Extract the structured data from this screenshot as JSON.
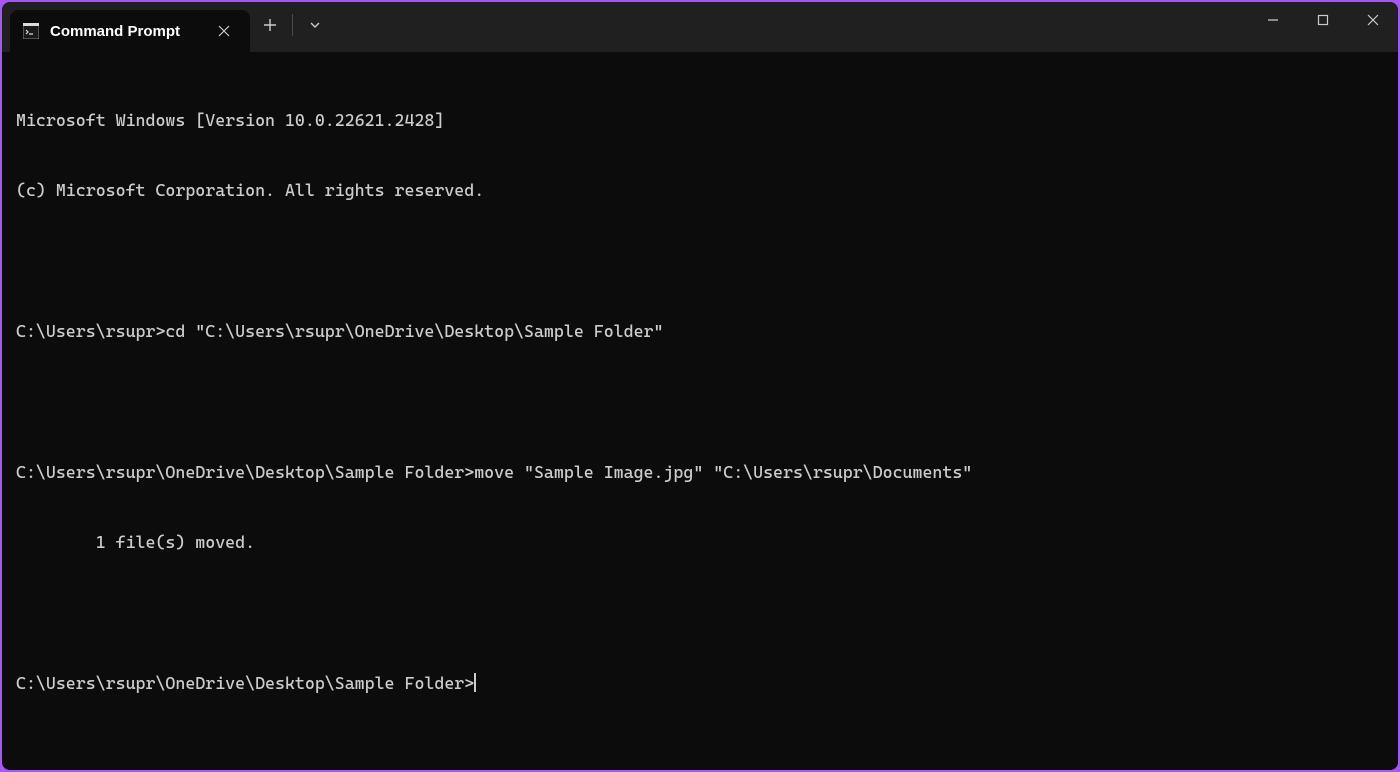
{
  "titlebar": {
    "tab_title": "Command Prompt",
    "close_tab_glyph": "✕",
    "new_tab_glyph": "+",
    "dropdown_glyph": "⌄",
    "minimize_glyph": "—",
    "maximize_glyph": "▢",
    "close_glyph": "✕"
  },
  "terminal": {
    "header_line1": "Microsoft Windows [Version 10.0.22621.2428]",
    "header_line2": "(c) Microsoft Corporation. All rights reserved.",
    "blank": "",
    "prompt1": "C:\\Users\\rsupr>cd \"C:\\Users\\rsupr\\OneDrive\\Desktop\\Sample Folder\"",
    "prompt2": "C:\\Users\\rsupr\\OneDrive\\Desktop\\Sample Folder>move \"Sample Image.jpg\" \"C:\\Users\\rsupr\\Documents\"",
    "result": "        1 file(s) moved.",
    "prompt3": "C:\\Users\\rsupr\\OneDrive\\Desktop\\Sample Folder>"
  }
}
